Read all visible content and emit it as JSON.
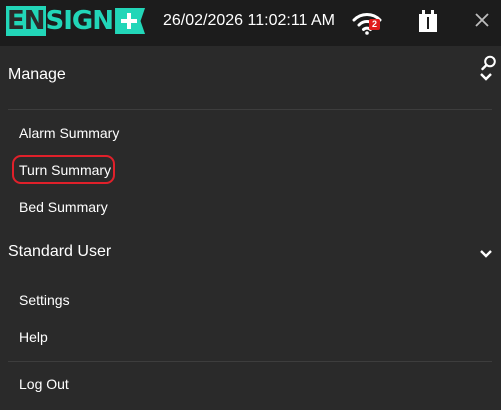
{
  "header": {
    "logo_text": "ENSIGN",
    "datetime": "26/02/2026 11:02:11 AM",
    "wifi_badge": "2",
    "brand_color": "#22d6b8",
    "icons": [
      "wifi-icon",
      "battery-icon",
      "close-icon",
      "search-icon"
    ]
  },
  "sections": [
    {
      "title": "Manage",
      "icon": "chevron-down-icon",
      "items": [
        {
          "label": "Alarm Summary"
        },
        {
          "label": "Turn Summary",
          "highlighted": true
        },
        {
          "label": "Bed Summary"
        }
      ]
    },
    {
      "title": "Standard User",
      "icon": "chevron-down-icon",
      "items": [
        {
          "label": "Settings"
        },
        {
          "label": "Help"
        },
        {
          "label": "Log Out"
        }
      ]
    }
  ],
  "highlight_color": "#e0202a"
}
